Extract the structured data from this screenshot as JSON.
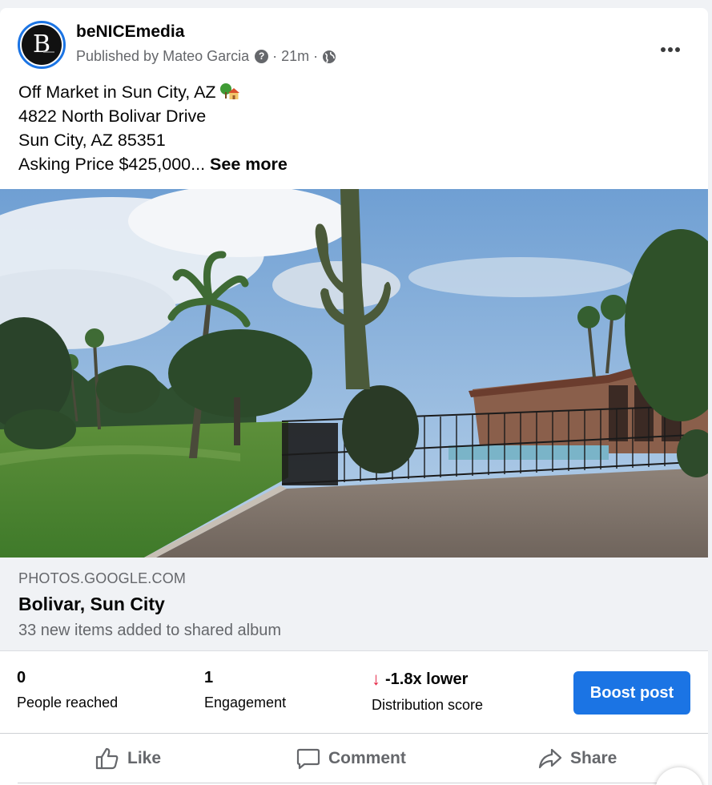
{
  "post": {
    "page_name": "beNICEmedia",
    "avatar_letter": "B",
    "published_by": "Published by Mateo Garcia",
    "time": "· 21m ·",
    "text_lines": [
      "Off Market in Sun City, AZ",
      "4822 North Bolivar Drive",
      "Sun City, AZ 85351",
      "Asking Price $425,000..."
    ],
    "see_more": "See more"
  },
  "link_preview": {
    "domain": "PHOTOS.GOOGLE.COM",
    "title": "Bolivar, Sun City",
    "description": "33 new items added to shared album"
  },
  "insights": {
    "people_reached_value": "0",
    "people_reached_label": "People reached",
    "engagement_value": "1",
    "engagement_label": "Engagement",
    "distribution_value": "-1.8x lower",
    "distribution_label": "Distribution score",
    "distribution_arrow": "↓",
    "boost_label": "Boost post"
  },
  "actions": {
    "like": "Like",
    "comment": "Comment",
    "share": "Share"
  },
  "colors": {
    "accent": "#1b74e4",
    "negative": "#e41e3f",
    "secondary_text": "#65676b"
  },
  "icons": [
    "help-icon",
    "globe-icon",
    "house-emoji-icon",
    "more-icon",
    "down-arrow-icon",
    "like-icon",
    "comment-icon",
    "share-icon"
  ]
}
